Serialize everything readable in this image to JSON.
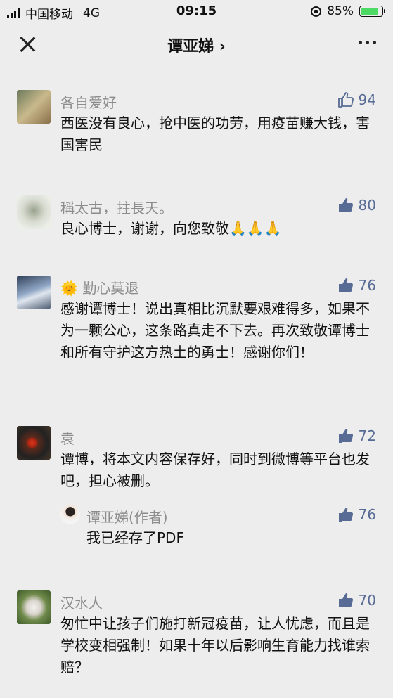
{
  "status_bar": {
    "carrier": "中国移动",
    "network": "4G",
    "time": "09:15",
    "battery": "85%",
    "battery_level": 0.85
  },
  "nav": {
    "title": "谭亚娣 ›"
  },
  "comments": [
    {
      "user": "各自爱好",
      "text": "西医没有良心，抢中医的功劳，用疫苗赚大钱，害国害民",
      "likes": "94",
      "liked": false
    },
    {
      "user": "稱太古，拄長天。",
      "text": "良心博士，谢谢，向您致敬🙏🙏🙏",
      "likes": "80",
      "liked": true
    },
    {
      "user": "🌞 勤心莫退",
      "text": "感谢谭博士！说出真相比沉默要艰难得多，如果不为一颗公心，这条路真走不下去。再次致敬谭博士和所有守护这方热土的勇士！感谢你们！",
      "likes": "76",
      "liked": true
    },
    {
      "user": "袁",
      "text": "谭博，将本文内容保存好，同时到微博等平台也发吧，担心被删。",
      "likes": "72",
      "liked": true
    },
    {
      "user": "汉水人",
      "text": "匆忙中让孩子们施打新冠疫苗，让人忧虑，而且是学校变相强制！如果十年以后影响生育能力找谁索赔？",
      "likes": "70",
      "liked": true
    }
  ],
  "reply": {
    "user": "谭亚娣(作者)",
    "text": "我已经存了PDF",
    "likes": "76",
    "liked": true
  },
  "colors": {
    "like_blue": "#576b95",
    "like_gray": "#576b95",
    "name_gray": "#8c8c8c",
    "background": "#ededed"
  }
}
